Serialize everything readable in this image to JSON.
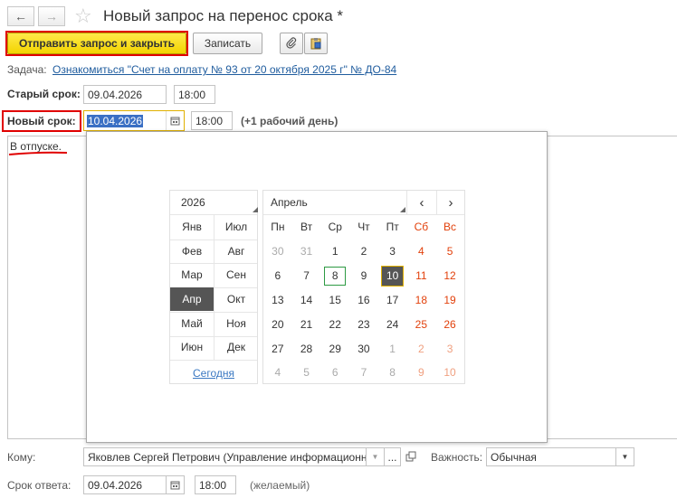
{
  "header": {
    "title": "Новый запрос на перенос срока *"
  },
  "toolbar": {
    "send_close_label": "Отправить запрос и закрыть",
    "save_label": "Записать"
  },
  "task": {
    "label": "Задача:",
    "link": "Ознакомиться \"Счет на оплату № 93 от 20 октября 2025 г\" № ДО-84"
  },
  "old_deadline": {
    "label": "Старый срок:",
    "date": "09.04.2026",
    "time": "18:00"
  },
  "new_deadline": {
    "label": "Новый срок:",
    "date": "10.04.2026",
    "time": "18:00",
    "note": "(+1 рабочий день)"
  },
  "comment": {
    "text": "В отпуске."
  },
  "calendar": {
    "year": "2026",
    "month": "Апрель",
    "prev": "‹",
    "next": "›",
    "months": [
      [
        "Янв",
        "Июл"
      ],
      [
        "Фев",
        "Авг"
      ],
      [
        "Мар",
        "Сен"
      ],
      [
        "Апр",
        "Окт"
      ],
      [
        "Май",
        "Ноя"
      ],
      [
        "Июн",
        "Дек"
      ]
    ],
    "selected_month": "Апр",
    "today_label": "Сегодня",
    "weekdays": [
      "Пн",
      "Вт",
      "Ср",
      "Чт",
      "Пт",
      "Сб",
      "Вс"
    ],
    "weeks": [
      [
        "30",
        "31",
        "1",
        "2",
        "3",
        "4",
        "5"
      ],
      [
        "6",
        "7",
        "8",
        "9",
        "10",
        "11",
        "12"
      ],
      [
        "13",
        "14",
        "15",
        "16",
        "17",
        "18",
        "19"
      ],
      [
        "20",
        "21",
        "22",
        "23",
        "24",
        "25",
        "26"
      ],
      [
        "27",
        "28",
        "29",
        "30",
        "1",
        "2",
        "3"
      ],
      [
        "4",
        "5",
        "6",
        "7",
        "8",
        "9",
        "10"
      ]
    ],
    "today_day": "8",
    "selected_day": "10"
  },
  "recipient": {
    "label": "Кому:",
    "value": "Яковлев Сергей Петрович (Управление информационны",
    "more": "..."
  },
  "importance": {
    "label": "Важность:",
    "value": "Обычная"
  },
  "reply_deadline": {
    "label": "Срок ответа:",
    "date": "09.04.2026",
    "time": "18:00",
    "note": "(желаемый)"
  },
  "colors": {
    "accent_yellow": "#f3d400",
    "annotation_red": "#e00000",
    "link_blue": "#1f5c9e",
    "weekend_red": "#e2410c",
    "selected_gray": "#555555",
    "today_green": "#2d9a43"
  }
}
